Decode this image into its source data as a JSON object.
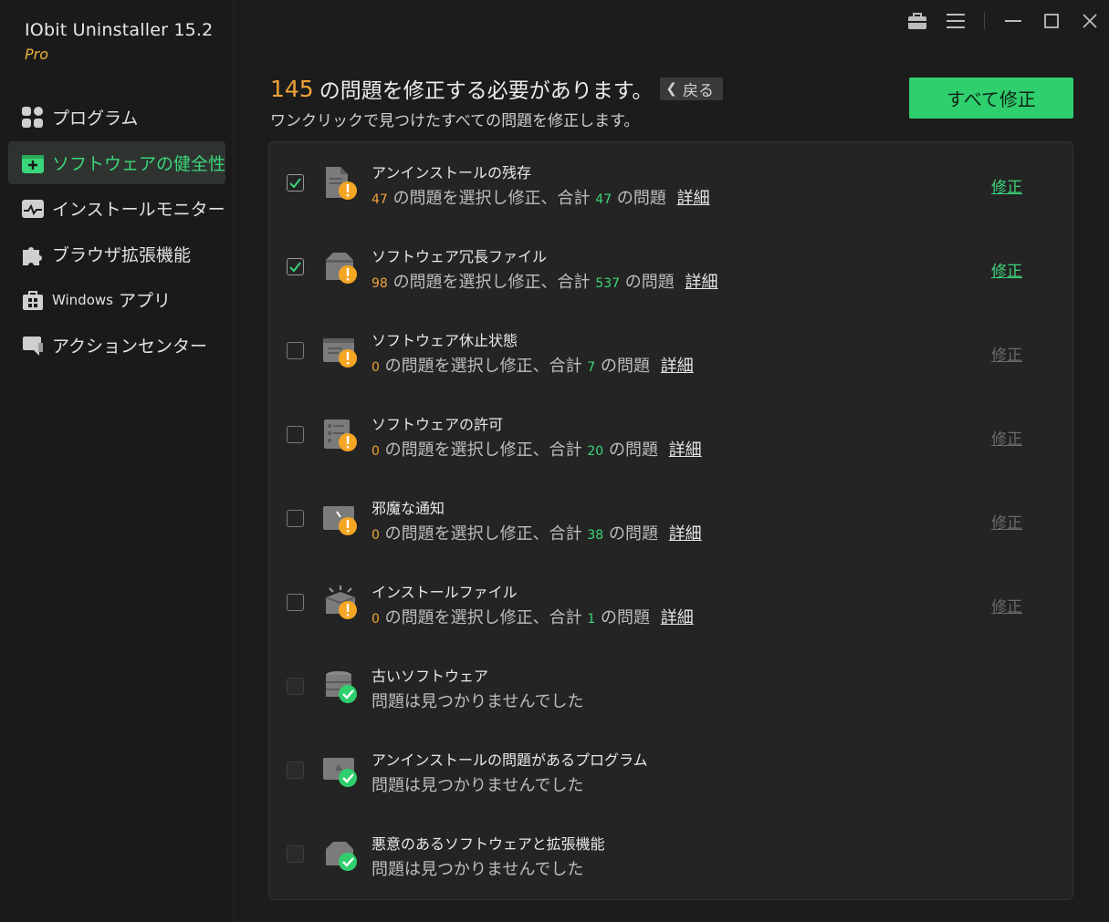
{
  "app": {
    "name": "IObit Uninstaller 15.2",
    "edition": "Pro"
  },
  "sidebar": {
    "items": [
      {
        "label": "プログラム",
        "icon": "apps-grid-icon"
      },
      {
        "label": "ソフトウェアの健全性",
        "icon": "health-kit-icon",
        "active": true
      },
      {
        "label": "インストールモニター",
        "icon": "monitor-pulse-icon"
      },
      {
        "label": "ブラウザ拡張機能",
        "icon": "puzzle-icon"
      },
      {
        "label_prefix": "Windows",
        "label": "アプリ",
        "icon": "windows-store-icon"
      },
      {
        "label": "アクションセンター",
        "icon": "action-center-icon"
      }
    ]
  },
  "header": {
    "count": "145",
    "headline": "の問題を修正する必要があります。",
    "back_label": "戻る",
    "subtitle": "ワンクリックで見つけたすべての問題を修正します。",
    "fix_all_label": "すべて修正"
  },
  "rows": [
    {
      "title": "アンインストールの残存",
      "selected": "47",
      "total": "47",
      "checked": true,
      "fixable": true,
      "status": "warning"
    },
    {
      "title": "ソフトウェア冗長ファイル",
      "selected": "98",
      "total": "537",
      "checked": true,
      "fixable": true,
      "status": "warning"
    },
    {
      "title": "ソフトウェア休止状態",
      "selected": "0",
      "total": "7",
      "checked": false,
      "fixable": false,
      "status": "warning"
    },
    {
      "title": "ソフトウェアの許可",
      "selected": "0",
      "total": "20",
      "checked": false,
      "fixable": false,
      "status": "warning"
    },
    {
      "title": "邪魔な通知",
      "selected": "0",
      "total": "38",
      "checked": false,
      "fixable": false,
      "status": "warning"
    },
    {
      "title": "インストールファイル",
      "selected": "0",
      "total": "1",
      "checked": false,
      "fixable": false,
      "status": "warning"
    },
    {
      "title": "古いソフトウェア",
      "none": "問題は見つかりませんでした",
      "status": "ok"
    },
    {
      "title": "アンインストールの問題があるプログラム",
      "none": "問題は見つかりませんでした",
      "status": "ok"
    },
    {
      "title": "悪意のあるソフトウェアと拡張機能",
      "none": "問題は見つかりませんでした",
      "status": "ok"
    }
  ],
  "strings": {
    "desc_mid": "の問題を選択し修正、合計",
    "desc_end": "の問題",
    "detail": "詳細",
    "fix": "修正"
  },
  "colors": {
    "accent": "#3bd679",
    "warning": "#f0a33a",
    "fix_all_bg": "#2fcf6d"
  }
}
